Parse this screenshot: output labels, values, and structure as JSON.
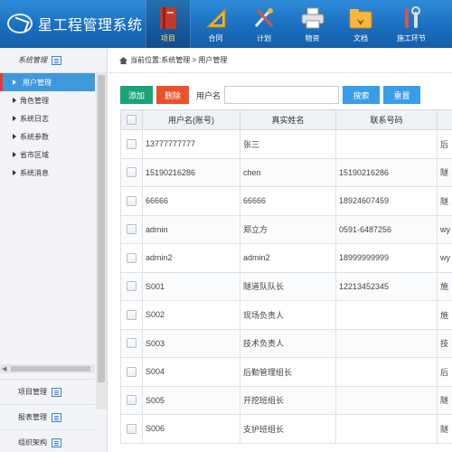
{
  "app": {
    "title": "星工程管理系统"
  },
  "nav": [
    {
      "label": "项目",
      "icon": "book-icon",
      "active": true
    },
    {
      "label": "合同",
      "icon": "ruler-icon",
      "active": false
    },
    {
      "label": "计划",
      "icon": "tools-icon",
      "active": false
    },
    {
      "label": "物资",
      "icon": "printer-icon",
      "active": false
    },
    {
      "label": "文档",
      "icon": "folder-download-icon",
      "active": false
    },
    {
      "label": "施工环节",
      "icon": "wrench-icon",
      "active": false
    }
  ],
  "sidebar": {
    "title": "系统管理",
    "items": [
      {
        "label": "用户管理",
        "active": true
      },
      {
        "label": "角色管理",
        "active": false
      },
      {
        "label": "系统日志",
        "active": false
      },
      {
        "label": "系统参数",
        "active": false
      },
      {
        "label": "省市区域",
        "active": false
      },
      {
        "label": "系统消息",
        "active": false
      }
    ],
    "groups": [
      "项目管理",
      "报表管理",
      "组织架构"
    ]
  },
  "breadcrumb": {
    "text": "当前位置:系统管理 > 用户管理"
  },
  "toolbar": {
    "add_label": "添加",
    "delete_label": "删除",
    "username_label": "用户名",
    "username_value": "",
    "search_label": "搜索",
    "reset_label": "重置"
  },
  "table": {
    "headers": [
      "用户名(账号)",
      "真实姓名",
      "联系号码",
      ""
    ],
    "rows": [
      [
        "13777777777",
        "张三",
        "",
        "后"
      ],
      [
        "15190216286",
        "chen",
        "15190216286",
        "隧"
      ],
      [
        "66666",
        "66666",
        "18924607459",
        "隧"
      ],
      [
        "admin",
        "郑立方",
        "0591-6487256",
        "wy"
      ],
      [
        "admin2",
        "admin2",
        "18999999999",
        "wy"
      ],
      [
        "S001",
        "隧道队队长",
        "12213452345",
        "施"
      ],
      [
        "S002",
        "现场负责人",
        "",
        "施"
      ],
      [
        "S003",
        "技术负责人",
        "",
        "技"
      ],
      [
        "S004",
        "后勤管理组长",
        "",
        "后"
      ],
      [
        "S005",
        "开挖班组长",
        "",
        "隧"
      ],
      [
        "S006",
        "支护班组长",
        "",
        "隧"
      ]
    ]
  },
  "colors": {
    "header_blue": "#1b6fc0",
    "active_nav_label": "#ffe16b",
    "sidebar_active": "#3f98db",
    "add_button": "#1aa37a",
    "delete_button": "#e8532b",
    "search_button": "#3a9de8"
  }
}
